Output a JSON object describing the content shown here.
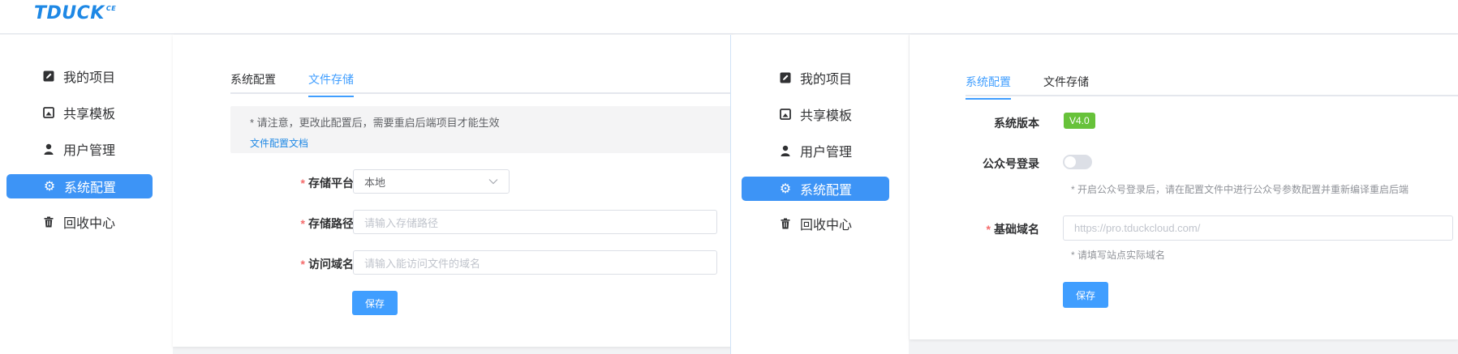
{
  "app": {
    "logo": "TDUCK",
    "logo_sup": "CE"
  },
  "sidebar": {
    "items": [
      {
        "label": "我的项目",
        "icon": "edit-icon"
      },
      {
        "label": "共享模板",
        "icon": "image-icon"
      },
      {
        "label": "用户管理",
        "icon": "user-icon"
      },
      {
        "label": "系统配置",
        "icon": "gear-icon"
      },
      {
        "label": "回收中心",
        "icon": "trash-icon"
      }
    ],
    "active_index": 3
  },
  "left_panel": {
    "tabs": [
      "系统配置",
      "文件存储"
    ],
    "active_tab": 1,
    "alert": {
      "text": "* 请注意，更改此配置后，需要重启后端项目才能生效",
      "link": "文件配置文档"
    },
    "fields": {
      "storage_platform": {
        "label": "存储平台",
        "value": "本地"
      },
      "storage_path": {
        "label": "存储路径",
        "placeholder": "请输入存储路径"
      },
      "access_domain": {
        "label": "访问域名",
        "placeholder": "请输入能访问文件的域名"
      }
    },
    "save_label": "保存"
  },
  "right_panel": {
    "tabs": [
      "系统配置",
      "文件存储"
    ],
    "active_tab": 0,
    "version": {
      "label": "系统版本",
      "value": "V4.0"
    },
    "wechat_login": {
      "label": "公众号登录",
      "enabled": false,
      "hint": "* 开启公众号登录后，请在配置文件中进行公众号参数配置并重新编译重启后端"
    },
    "base_domain": {
      "label": "基础域名",
      "placeholder": "https://pro.tduckcloud.com/",
      "hint": "* 请填写站点实际域名"
    },
    "save_label": "保存"
  },
  "colors": {
    "accent": "#409eff",
    "active_nav": "#3d94f6",
    "success": "#67c23a",
    "required": "#f56c6c"
  }
}
